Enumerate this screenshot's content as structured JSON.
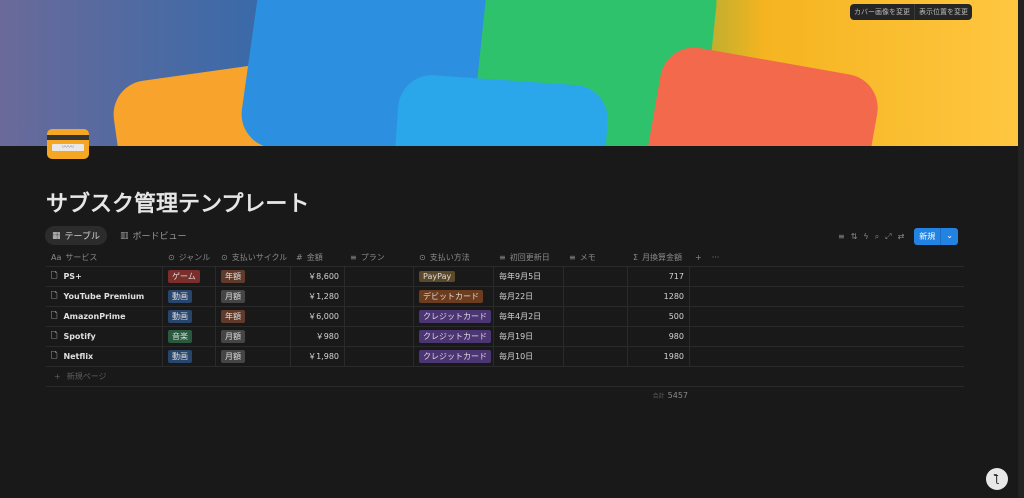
{
  "cover": {
    "change_image": "カバー画像を変更",
    "reposition": "表示位置を変更"
  },
  "page": {
    "title": "サブスク管理テンプレート"
  },
  "views": [
    {
      "label": "テーブル"
    },
    {
      "label": "ボードビュー"
    }
  ],
  "toolbar": {
    "new_label": "新規"
  },
  "columns": [
    {
      "icon": "Aa",
      "label": "サービス"
    },
    {
      "icon": "⊙",
      "label": "ジャンル"
    },
    {
      "icon": "⊙",
      "label": "支払いサイクル"
    },
    {
      "icon": "#",
      "label": "金額"
    },
    {
      "icon": "≡",
      "label": "プラン"
    },
    {
      "icon": "⊙",
      "label": "支払い方法"
    },
    {
      "icon": "≡",
      "label": "初回更新日"
    },
    {
      "icon": "≡",
      "label": "メモ"
    },
    {
      "icon": "Σ",
      "label": "月換算金額"
    }
  ],
  "rows": [
    {
      "service": "PS+",
      "genre": "ゲーム",
      "cycle": "年額",
      "amount": "￥8,600",
      "plan": "",
      "method": "PayPay",
      "date": "毎年9月5日",
      "memo": "",
      "monthly": "717"
    },
    {
      "service": "YouTube Premium",
      "genre": "動画",
      "cycle": "月額",
      "amount": "￥1,280",
      "plan": "",
      "method": "デビットカード",
      "date": "毎月22日",
      "memo": "",
      "monthly": "1280"
    },
    {
      "service": "AmazonPrime",
      "genre": "動画",
      "cycle": "年額",
      "amount": "￥6,000",
      "plan": "",
      "method": "クレジットカード",
      "date": "毎年4月2日",
      "memo": "",
      "monthly": "500"
    },
    {
      "service": "Spotify",
      "genre": "音楽",
      "cycle": "月額",
      "amount": "￥980",
      "plan": "",
      "method": "クレジットカード",
      "date": "毎月19日",
      "memo": "",
      "monthly": "980"
    },
    {
      "service": "Netflix",
      "genre": "動画",
      "cycle": "月額",
      "amount": "￥1,980",
      "plan": "",
      "method": "クレジットカード",
      "date": "毎月10日",
      "memo": "",
      "monthly": "1980"
    }
  ],
  "new_page": "新規ページ",
  "footer": {
    "sum_label": "合計",
    "sum_value": "5457"
  },
  "colors": {
    "ゲーム": "#7a2f2a",
    "動画": "#28456c",
    "音楽": "#2b593f",
    "年額": "#603b2c",
    "月額": "#454545",
    "PayPay": "#5a4a2a",
    "デビットカード": "#6b3d1e",
    "クレジットカード": "#4c3573",
    "accent": "#2383e2"
  }
}
